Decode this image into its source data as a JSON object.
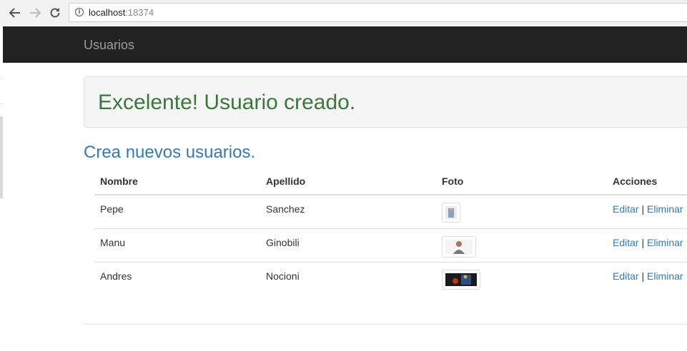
{
  "browser": {
    "url_host": "localhost",
    "url_port": ":18374",
    "back_icon": "arrow-left-icon",
    "forward_icon": "arrow-right-icon",
    "reload_icon": "reload-icon",
    "info_icon": "info-icon"
  },
  "navbar": {
    "brand": "Usuarios",
    "background": "#222222"
  },
  "alert": {
    "message": "Excelente! Usuario creado.",
    "color": "#3c763d"
  },
  "create_link": "Crea nuevos usuarios.",
  "table": {
    "headers": {
      "nombre": "Nombre",
      "apellido": "Apellido",
      "foto": "Foto",
      "acciones": "Acciones"
    },
    "rows": [
      {
        "nombre": "Pepe",
        "apellido": "Sanchez",
        "edit": "Editar",
        "sep": "|",
        "delete": "Eliminar"
      },
      {
        "nombre": "Manu",
        "apellido": "Ginobili",
        "edit": "Editar",
        "sep": "|",
        "delete": "Eliminar"
      },
      {
        "nombre": "Andres",
        "apellido": "Nocioni",
        "edit": "Editar",
        "sep": "|",
        "delete": "Eliminar"
      }
    ]
  },
  "colors": {
    "link": "#337ab7",
    "success_text": "#3c763d"
  }
}
